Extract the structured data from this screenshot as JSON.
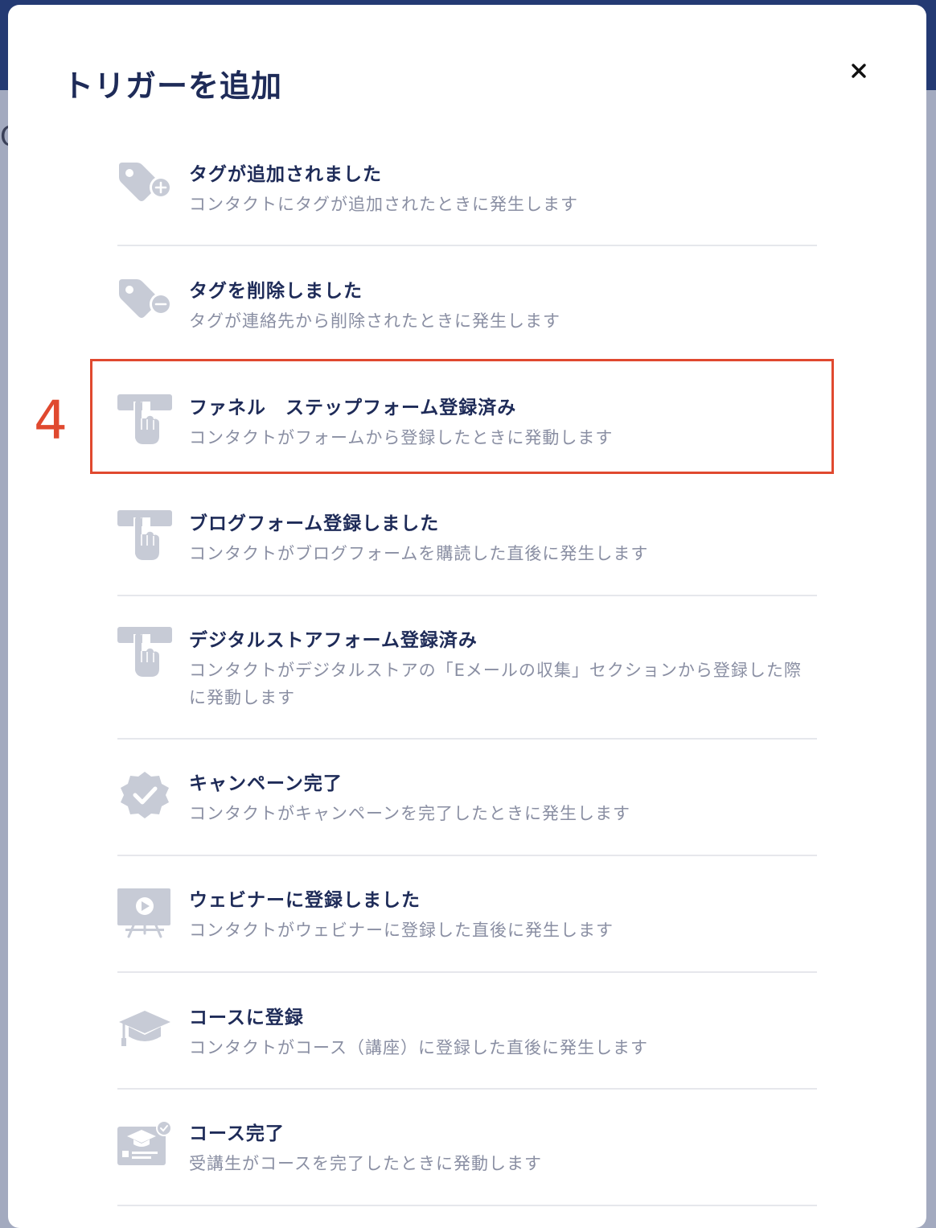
{
  "modal": {
    "title": "トリガーを追加",
    "close_icon": "×"
  },
  "annotation": {
    "step_number": "4",
    "highlight_color": "#e0492f"
  },
  "colors": {
    "title": "#1e2b58",
    "description": "#8a8fa3",
    "icon": "#c7cbd6",
    "header_background": "#243a73"
  },
  "triggers": [
    {
      "icon": "tag-plus-icon",
      "title": "タグが追加されました",
      "description": "コンタクトにタグが追加されたときに発生します"
    },
    {
      "icon": "tag-minus-icon",
      "title": "タグを削除しました",
      "description": "タグが連絡先から削除されたときに発生します"
    },
    {
      "icon": "hand-pointer-form-icon",
      "title": "ファネル　ステップフォーム登録済み",
      "description": "コンタクトがフォームから登録したときに発動します"
    },
    {
      "icon": "hand-pointer-form-icon",
      "title": "ブログフォーム登録しました",
      "description": "コンタクトがブログフォームを購読した直後に発生します"
    },
    {
      "icon": "hand-pointer-form-icon",
      "title": "デジタルストアフォーム登録済み",
      "description": "コンタクトがデジタルストアの「Eメールの収集」セクションから登録した際に発動します"
    },
    {
      "icon": "check-badge-icon",
      "title": "キャンペーン完了",
      "description": "コンタクトがキャンペーンを完了したときに発生します"
    },
    {
      "icon": "webinar-screen-icon",
      "title": "ウェビナーに登録しました",
      "description": "コンタクトがウェビナーに登録した直後に発生します"
    },
    {
      "icon": "graduation-cap-icon",
      "title": "コースに登録",
      "description": "コンタクトがコース（講座）に登録した直後に発生します"
    },
    {
      "icon": "course-certificate-icon",
      "title": "コース完了",
      "description": "受講生がコースを完了したときに発動します"
    }
  ]
}
